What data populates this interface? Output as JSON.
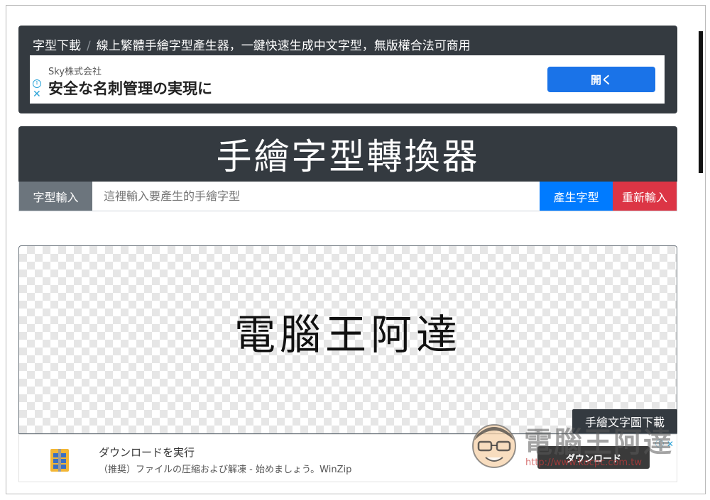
{
  "breadcrumb": {
    "items": [
      "字型下載",
      "線上繁體手繪字型產生器，一鍵快速生成中文字型，無版權合法可商用"
    ],
    "separator": "/"
  },
  "top_ad": {
    "company": "Sky株式会社",
    "headline": "安全な名刺管理の実現に",
    "button": "開く",
    "info_icon": "i",
    "close_icon": "✕"
  },
  "banner": {
    "title": "手繪字型轉換器"
  },
  "form": {
    "input_label": "字型輸入",
    "input_value": "",
    "input_placeholder": "這裡輸入要產生的手繪字型",
    "generate_button": "產生字型",
    "reset_button": "重新輸入"
  },
  "preview": {
    "text": "電腦王阿達",
    "download_label": "手繪文字圖下載"
  },
  "bottom_ad": {
    "title": "ダウンロードを実行",
    "description": "（推奨）ファイルの圧縮および解凍 - 始めましょう。WinZip",
    "button": "ダウンロード",
    "info_icon": "ⓘ ✕"
  },
  "watermark": {
    "title": "電腦王阿達",
    "url": "http://www.kocpc.com.tw"
  },
  "colors": {
    "dark": "#343a40",
    "primary": "#007bff",
    "danger": "#dc3545",
    "secondary": "#6c757d",
    "ad_blue": "#1a73e8"
  }
}
